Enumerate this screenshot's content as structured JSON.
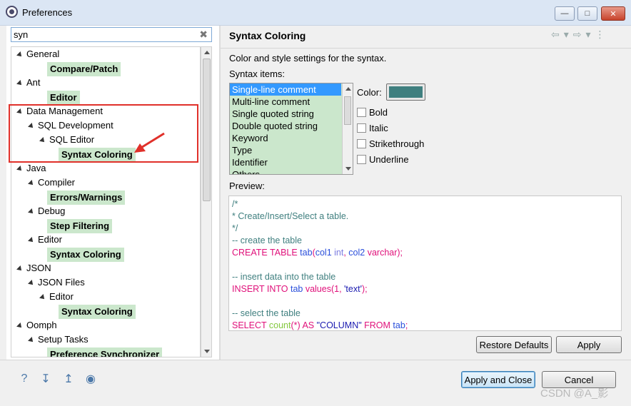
{
  "window": {
    "title": "Preferences",
    "min_glyph": "—",
    "max_glyph": "□",
    "close_glyph": "✕"
  },
  "filter": {
    "value": "syn",
    "clear_glyph": "✖"
  },
  "tree": [
    {
      "label": "General",
      "level": 0,
      "expandable": true,
      "highlight": false
    },
    {
      "label": "Compare/Patch",
      "level": 2,
      "expandable": false,
      "highlight": true
    },
    {
      "label": "Ant",
      "level": 0,
      "expandable": true,
      "highlight": false
    },
    {
      "label": "Editor",
      "level": 2,
      "expandable": false,
      "highlight": true
    },
    {
      "label": "Data Management",
      "level": 0,
      "expandable": true,
      "highlight": false
    },
    {
      "label": "SQL Development",
      "level": 1,
      "expandable": true,
      "highlight": false
    },
    {
      "label": "SQL Editor",
      "level": 2,
      "expandable": true,
      "highlight": false
    },
    {
      "label": "Syntax Coloring",
      "level": 3,
      "expandable": false,
      "highlight": true
    },
    {
      "label": "Java",
      "level": 0,
      "expandable": true,
      "highlight": false
    },
    {
      "label": "Compiler",
      "level": 1,
      "expandable": true,
      "highlight": false
    },
    {
      "label": "Errors/Warnings",
      "level": 2,
      "expandable": false,
      "highlight": true
    },
    {
      "label": "Debug",
      "level": 1,
      "expandable": true,
      "highlight": false
    },
    {
      "label": "Step Filtering",
      "level": 2,
      "expandable": false,
      "highlight": true
    },
    {
      "label": "Editor",
      "level": 1,
      "expandable": true,
      "highlight": false
    },
    {
      "label": "Syntax Coloring",
      "level": 2,
      "expandable": false,
      "highlight": true
    },
    {
      "label": "JSON",
      "level": 0,
      "expandable": true,
      "highlight": false
    },
    {
      "label": "JSON Files",
      "level": 1,
      "expandable": true,
      "highlight": false
    },
    {
      "label": "Editor",
      "level": 2,
      "expandable": true,
      "highlight": false
    },
    {
      "label": "Syntax Coloring",
      "level": 3,
      "expandable": false,
      "highlight": true
    },
    {
      "label": "Oomph",
      "level": 0,
      "expandable": true,
      "highlight": false
    },
    {
      "label": "Setup Tasks",
      "level": 1,
      "expandable": true,
      "highlight": false
    },
    {
      "label": "Preference Synchronizer",
      "level": 2,
      "expandable": false,
      "highlight": true
    }
  ],
  "page": {
    "title": "Syntax Coloring",
    "nav_glyphs": [
      "⇦",
      "▾",
      "⇨",
      "▾",
      "⋮"
    ],
    "description": "Color and style settings for the syntax.",
    "syntax_items_label": "Syntax items:",
    "syntax_items": [
      "Single-line comment",
      "Multi-line comment",
      "Single quoted string",
      "Double quoted string",
      "Keyword",
      "Type",
      "Identifier",
      "Others"
    ],
    "selected_item": 0,
    "color_label": "Color:",
    "color_value": "#3f7f7f",
    "checkboxes": [
      "Bold",
      "Italic",
      "Strikethrough",
      "Underline"
    ],
    "preview_label": "Preview:",
    "preview_lines": [
      [
        {
          "t": "/*",
          "c": "com"
        }
      ],
      [
        {
          "t": "* Create/Insert/Select a table.",
          "c": "com"
        }
      ],
      [
        {
          "t": "*/",
          "c": "com"
        }
      ],
      [
        {
          "t": "-- create the table",
          "c": "com"
        }
      ],
      [
        {
          "t": "CREATE TABLE ",
          "c": "kw"
        },
        {
          "t": "tab",
          "c": "id"
        },
        {
          "t": "(",
          "c": "kw"
        },
        {
          "t": "col1 ",
          "c": "id"
        },
        {
          "t": "int",
          "c": "type"
        },
        {
          "t": ", ",
          "c": "kw"
        },
        {
          "t": "col2 ",
          "c": "id"
        },
        {
          "t": "varchar",
          "c": "kw"
        },
        {
          "t": ");",
          "c": "kw"
        }
      ],
      [
        {
          "t": "",
          "c": "com"
        }
      ],
      [
        {
          "t": "-- insert data into the table",
          "c": "com"
        }
      ],
      [
        {
          "t": "INSERT INTO ",
          "c": "kw"
        },
        {
          "t": "tab ",
          "c": "id"
        },
        {
          "t": "values",
          "c": "kw"
        },
        {
          "t": "(1, ",
          "c": "kw"
        },
        {
          "t": "'text'",
          "c": "str"
        },
        {
          "t": ");",
          "c": "kw"
        }
      ],
      [
        {
          "t": "",
          "c": "com"
        }
      ],
      [
        {
          "t": "-- select the table",
          "c": "com"
        }
      ],
      [
        {
          "t": "SELECT ",
          "c": "kw"
        },
        {
          "t": "count",
          "c": "fn"
        },
        {
          "t": "(*) ",
          "c": "kw"
        },
        {
          "t": "AS ",
          "c": "kw"
        },
        {
          "t": "\"COLUMN\" ",
          "c": "str"
        },
        {
          "t": "FROM ",
          "c": "kw"
        },
        {
          "t": "tab",
          "c": "id"
        },
        {
          "t": ";",
          "c": "kw"
        }
      ]
    ],
    "restore_label": "Restore Defaults",
    "apply_label": "Apply"
  },
  "bottom": {
    "icons": [
      {
        "name": "help-icon",
        "glyph": "?"
      },
      {
        "name": "import-icon",
        "glyph": "↧"
      },
      {
        "name": "export-icon",
        "glyph": "↥"
      },
      {
        "name": "oomph-record-icon",
        "glyph": "◉"
      }
    ],
    "apply_close_label": "Apply and Close",
    "cancel_label": "Cancel"
  },
  "watermark": "CSDN @A_影",
  "colors": {
    "highlight": "#cbe7cc",
    "selection": "#3399ff",
    "annotation": "#e0302a"
  }
}
